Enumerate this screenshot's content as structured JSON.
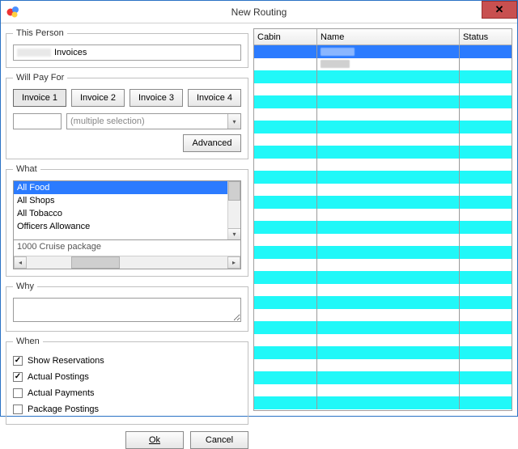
{
  "window": {
    "title": "New Routing",
    "close_label": "✕"
  },
  "person": {
    "legend": "This Person",
    "value_visible": "Invoices"
  },
  "payfor": {
    "legend": "Will Pay For",
    "tabs": [
      {
        "label": "Invoice 1",
        "active": true
      },
      {
        "label": "Invoice 2",
        "active": false
      },
      {
        "label": "Invoice 3",
        "active": false
      },
      {
        "label": "Invoice 4",
        "active": false
      }
    ],
    "combo_placeholder": "(multiple selection)",
    "advanced_label": "Advanced"
  },
  "what": {
    "legend": "What",
    "items": [
      {
        "label": "All Food",
        "selected": true
      },
      {
        "label": "All Shops",
        "selected": false
      },
      {
        "label": "All Tobacco",
        "selected": false
      },
      {
        "label": "Officers Allowance",
        "selected": false
      }
    ],
    "list2_text": "1000        Cruise package"
  },
  "why": {
    "legend": "Why",
    "value": ""
  },
  "when": {
    "legend": "When",
    "options": [
      {
        "label": "Show Reservations",
        "checked": true
      },
      {
        "label": "Actual Postings",
        "checked": true
      },
      {
        "label": "Actual Payments",
        "checked": false
      },
      {
        "label": "Package Postings",
        "checked": false
      }
    ]
  },
  "buttons": {
    "ok": "Ok",
    "cancel": "Cancel"
  },
  "grid": {
    "columns": {
      "cabin": "Cabin",
      "name": "Name",
      "status": "Status"
    },
    "selected_row_index": 0,
    "name_blur_rows": [
      0,
      1
    ],
    "total_rows": 29
  },
  "glyphs": {
    "check": "✓",
    "down": "▾",
    "left": "◂",
    "right": "▸"
  }
}
